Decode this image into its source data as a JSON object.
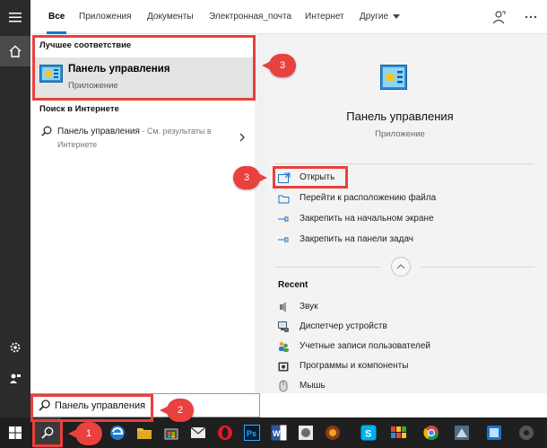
{
  "tabs": {
    "all": "Все",
    "apps": "Приложения",
    "documents": "Документы",
    "email": "Электронная_почта",
    "web": "Интернет",
    "more": "Другие"
  },
  "results": {
    "best_match_header": "Лучшее соответствие",
    "best_match_title": "Панель управления",
    "best_match_sub": "Приложение",
    "web_header": "Поиск в Интернете",
    "web_query": "Панель управления",
    "web_hint": " - См. результаты в Интернете"
  },
  "preview": {
    "title": "Панель управления",
    "subtitle": "Приложение",
    "actions": [
      {
        "label": "Открыть",
        "icon": "open-icon"
      },
      {
        "label": "Перейти к расположению файла",
        "icon": "folder-icon"
      },
      {
        "label": "Закрепить на начальном экране",
        "icon": "pin-icon"
      },
      {
        "label": "Закрепить на панели задач",
        "icon": "pin-icon"
      }
    ],
    "recent_header": "Recent",
    "recent": [
      {
        "label": "Звук",
        "icon": "speaker-icon"
      },
      {
        "label": "Диспетчер устройств",
        "icon": "device-manager-icon"
      },
      {
        "label": "Учетные записи пользователей",
        "icon": "users-icon"
      },
      {
        "label": "Программы и компоненты",
        "icon": "programs-icon"
      },
      {
        "label": "Мышь",
        "icon": "mouse-icon"
      }
    ]
  },
  "search": {
    "value": "Панель управления"
  },
  "annotations": {
    "callout_1": "1",
    "callout_2": "2",
    "callout_3a": "3",
    "callout_3b": "3",
    "color": "#e8413e"
  },
  "colors": {
    "accent": "#0078d7",
    "rail": "#2b2b2b",
    "taskbar": "#1f1f1f"
  }
}
